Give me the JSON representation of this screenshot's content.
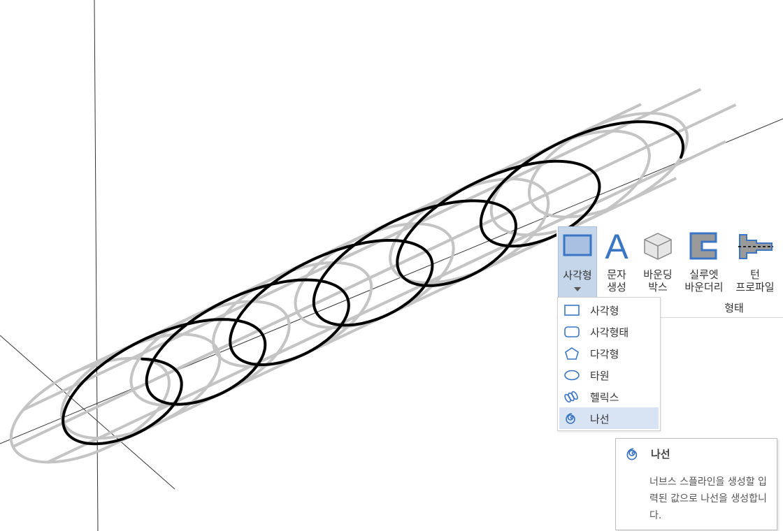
{
  "ribbon": {
    "buttons": [
      {
        "label_line1": "사각형",
        "label_line2": ""
      },
      {
        "label_line1": "문자",
        "label_line2": "생성"
      },
      {
        "label_line1": "바운딩",
        "label_line2": "박스"
      },
      {
        "label_line1": "실루엣",
        "label_line2": "바운더리"
      },
      {
        "label_line1": "턴",
        "label_line2": "프로파일"
      }
    ],
    "group_label": "형태",
    "selected_button": "사각형"
  },
  "dropdown": {
    "items": [
      {
        "label": "사각형",
        "icon": "rectangle-icon"
      },
      {
        "label": "사각형태",
        "icon": "rounded-rectangle-icon"
      },
      {
        "label": "다각형",
        "icon": "polygon-icon"
      },
      {
        "label": "타원",
        "icon": "ellipse-icon"
      },
      {
        "label": "헬릭스",
        "icon": "helix-icon"
      },
      {
        "label": "나선",
        "icon": "spiral-icon"
      }
    ],
    "highlighted": "나선"
  },
  "tooltip": {
    "title": "나선",
    "description": "너브스 스플라인을 생성할 입력된 값으로 나선을 생성합니다."
  },
  "colors": {
    "accent": "#3a76c4",
    "selection_bg": "#d8e4f3",
    "button_selected_bg": "#c5d5ea",
    "wire": "#c4c4c4",
    "helix": "#000000"
  }
}
